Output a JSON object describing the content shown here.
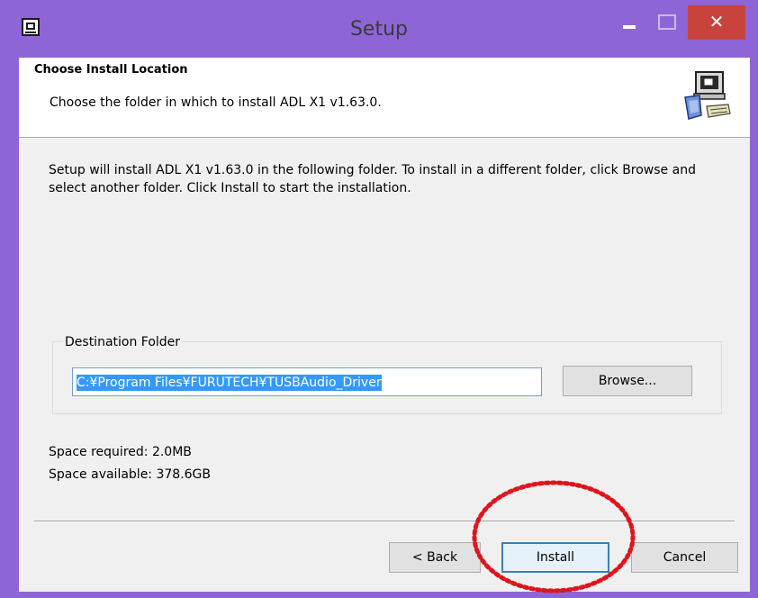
{
  "window": {
    "title": "Setup",
    "close_glyph": "✕",
    "accent_color": "#8e65d6",
    "close_color": "#c9433d"
  },
  "header": {
    "title": "Choose Install Location",
    "subtitle": "Choose the folder in which to install ADL X1 v1.63.0.",
    "icon": "installer-computer-icon"
  },
  "description": "Setup will install ADL X1 v1.63.0 in the following folder. To install in a different folder, click Browse and select another folder. Click Install to start the installation.",
  "destination": {
    "group_label": "Destination Folder",
    "path_value": "C:¥Program Files¥FURUTECH¥TUSBAudio_Driver",
    "browse_label": "Browse..."
  },
  "space": {
    "required": "Space required: 2.0MB",
    "available": "Space available: 378.6GB"
  },
  "buttons": {
    "back_label": "< Back",
    "install_label": "Install",
    "cancel_label": "Cancel"
  },
  "annotation": {
    "highlight_color": "#e0141e"
  }
}
